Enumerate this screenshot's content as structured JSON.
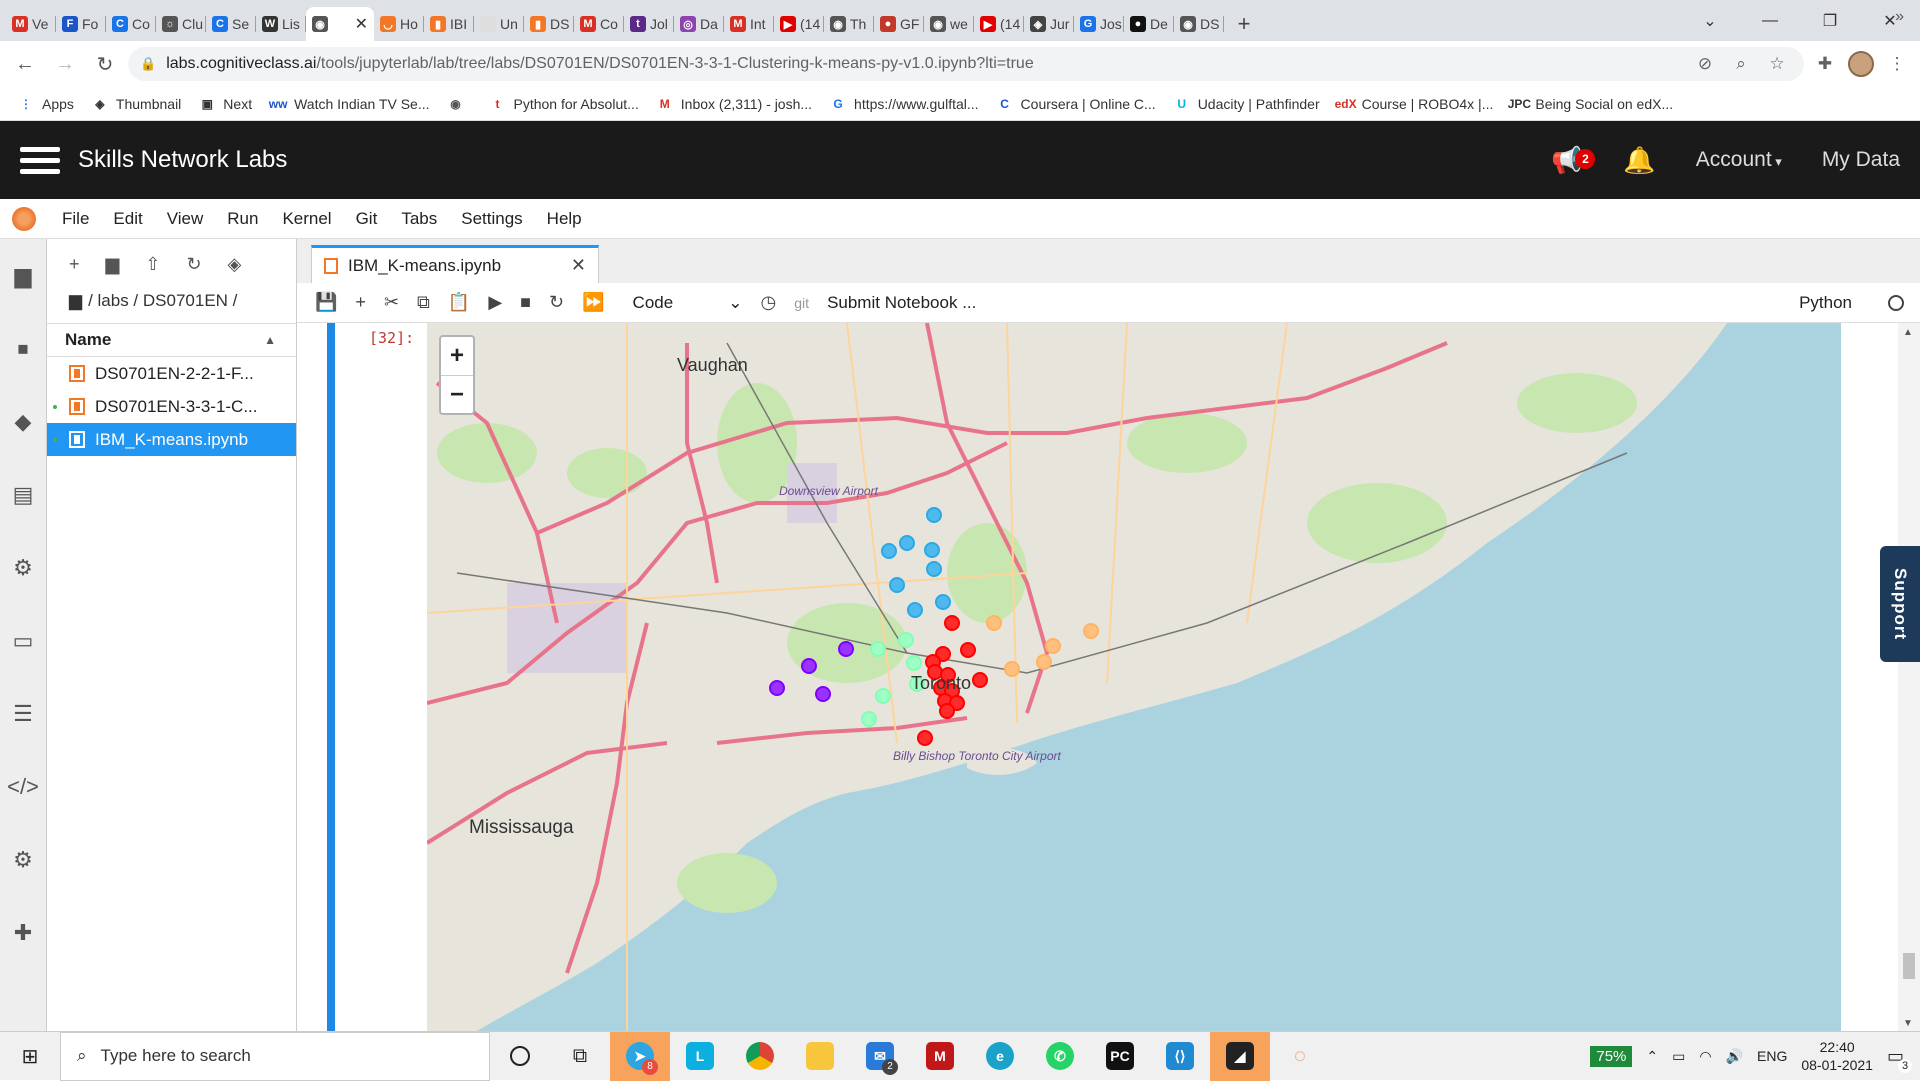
{
  "browser": {
    "tabs": [
      {
        "label": "Ve",
        "color": "#d93025",
        "glyph": "M"
      },
      {
        "label": "Fo",
        "color": "#1a56c8",
        "glyph": "F"
      },
      {
        "label": "Co",
        "color": "#1a73e8",
        "glyph": "C"
      },
      {
        "label": "Clu",
        "color": "#555555",
        "glyph": "☼"
      },
      {
        "label": "Se",
        "color": "#1a73e8",
        "glyph": "C"
      },
      {
        "label": "Lis",
        "color": "#333333",
        "glyph": "W"
      },
      {
        "label": "",
        "color": "#555555",
        "glyph": "◉",
        "active": true
      },
      {
        "label": "Ho",
        "color": "#f37726",
        "glyph": "◡"
      },
      {
        "label": "IBI",
        "color": "#f37726",
        "glyph": "▮"
      },
      {
        "label": "Un",
        "color": "#dddddd",
        "glyph": ""
      },
      {
        "label": "DS",
        "color": "#f37726",
        "glyph": "▮"
      },
      {
        "label": "Co",
        "color": "#d93025",
        "glyph": "M"
      },
      {
        "label": "Jol",
        "color": "#5b2a86",
        "glyph": "t"
      },
      {
        "label": "Da",
        "color": "#8e44ad",
        "glyph": "◎"
      },
      {
        "label": "Int",
        "color": "#d93025",
        "glyph": "M"
      },
      {
        "label": "(14",
        "color": "#e00000",
        "glyph": "▶"
      },
      {
        "label": "Th",
        "color": "#555555",
        "glyph": "◉"
      },
      {
        "label": "GF",
        "color": "#c0392b",
        "glyph": "●"
      },
      {
        "label": "we",
        "color": "#555555",
        "glyph": "◉"
      },
      {
        "label": "(14",
        "color": "#e00000",
        "glyph": "▶"
      },
      {
        "label": "Jur",
        "color": "#444444",
        "glyph": "◈"
      },
      {
        "label": "Jos",
        "color": "#1a73e8",
        "glyph": "G"
      },
      {
        "label": "De",
        "color": "#111111",
        "glyph": "●"
      },
      {
        "label": "DS",
        "color": "#555555",
        "glyph": "◉"
      }
    ],
    "new_tab_label": "+",
    "url_host": "labs.cognitiveclass.ai",
    "url_path": "/tools/jupyterlab/lab/tree/labs/DS0701EN/DS0701EN-3-3-1-Clustering-k-means-py-v1.0.ipynb?lti=true",
    "bookmarks": [
      {
        "label": "Apps",
        "color": "#4285f4",
        "glyph": "⋮"
      },
      {
        "label": "Thumbnail",
        "color": "#333333",
        "glyph": "◈"
      },
      {
        "label": "Next",
        "color": "#333333",
        "glyph": "▣"
      },
      {
        "label": "Watch Indian TV Se...",
        "color": "#1a56c8",
        "glyph": "ww"
      },
      {
        "label": "",
        "color": "#555555",
        "glyph": "◉"
      },
      {
        "label": "Python for Absolut...",
        "color": "#d93025",
        "glyph": "t"
      },
      {
        "label": "Inbox (2,311) - josh...",
        "color": "#d93025",
        "glyph": "M"
      },
      {
        "label": "https://www.gulftal...",
        "color": "#1a73e8",
        "glyph": "G"
      },
      {
        "label": "Coursera | Online C...",
        "color": "#1a56c8",
        "glyph": "C"
      },
      {
        "label": "Udacity | Pathfinder",
        "color": "#02b3e4",
        "glyph": "U"
      },
      {
        "label": "Course | ROBO4x |...",
        "color": "#d93025",
        "glyph": "edX"
      },
      {
        "label": "Being Social on edX...",
        "color": "#333333",
        "glyph": "JPC"
      }
    ],
    "bookmarks_more": "»"
  },
  "header": {
    "title": "Skills Network Labs",
    "notification_count": "2",
    "account_label": "Account",
    "mydata_label": "My Data"
  },
  "menubar": [
    "File",
    "Edit",
    "View",
    "Run",
    "Kernel",
    "Git",
    "Tabs",
    "Settings",
    "Help"
  ],
  "filebrowser": {
    "breadcrumb": "/ labs / DS0701EN /",
    "column_name": "Name",
    "files": [
      {
        "name": "DS0701EN-2-2-1-F...",
        "running": false,
        "selected": false
      },
      {
        "name": "DS0701EN-3-3-1-C...",
        "running": true,
        "selected": false
      },
      {
        "name": "IBM_K-means.ipynb",
        "running": true,
        "selected": true
      }
    ]
  },
  "notebook": {
    "tab_title": "IBM_K-means.ipynb",
    "cell_type": "Code",
    "git_label": "git",
    "submit_label": "Submit Notebook ...",
    "kernel_name": "Python",
    "cell_prompt": "[32]:"
  },
  "map": {
    "zoom_in": "+",
    "zoom_out": "−",
    "places": [
      "Vaughan",
      "Downsview Airport",
      "Toronto",
      "Billy Bishop Toronto City Airport",
      "Mississauga"
    ],
    "cluster_colors": {
      "red": "#ff0000",
      "purple": "#8000ff",
      "blue": "#2adddd",
      "green": "#80ffb4",
      "orange": "#ffb360",
      "light_blue": "#2aa9e6"
    }
  },
  "support_label": "Support",
  "taskbar": {
    "search_placeholder": "Type here to search",
    "telegram_badge": "8",
    "mail_badge": "2",
    "battery": "75%",
    "language": "ENG",
    "time": "22:40",
    "date": "08-01-2021",
    "notifications": "3"
  }
}
